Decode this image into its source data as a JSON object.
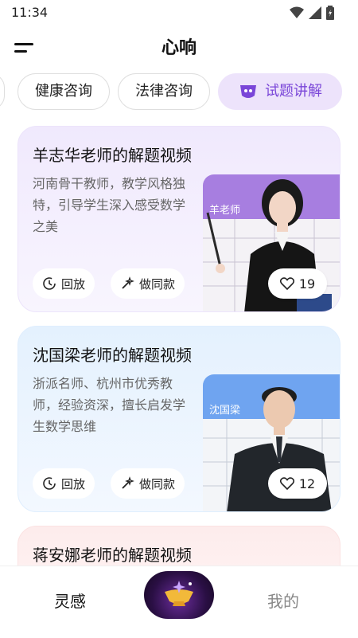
{
  "status": {
    "time": "11:34"
  },
  "header": {
    "title": "心响"
  },
  "tabs": [
    {
      "label": "健康咨询"
    },
    {
      "label": "法律咨询"
    },
    {
      "label": "试题讲解",
      "active": true
    }
  ],
  "cards": [
    {
      "title": "羊志华老师的解题视频",
      "description": "河南骨干教师，教学风格独特，引导学生深入感受数学之美",
      "replay_label": "回放",
      "same_label": "做同款",
      "likes": "19",
      "thumb_caption": "羊老师",
      "thumb_bg": "#a77ee0"
    },
    {
      "title": "沈国梁老师的解题视频",
      "description": "浙派名师、杭州市优秀教师，经验资深，擅长启发学生数学思维",
      "replay_label": "回放",
      "same_label": "做同款",
      "likes": "12",
      "thumb_caption": "沈国梁",
      "thumb_bg": "#6fa4f0"
    },
    {
      "title": "蒋安娜老师的解题视频"
    }
  ],
  "bottom_nav": {
    "left": "灵感",
    "right": "我的"
  },
  "colors": {
    "accent": "#7a46d8",
    "tab_active_bg": "#ede3fb"
  }
}
